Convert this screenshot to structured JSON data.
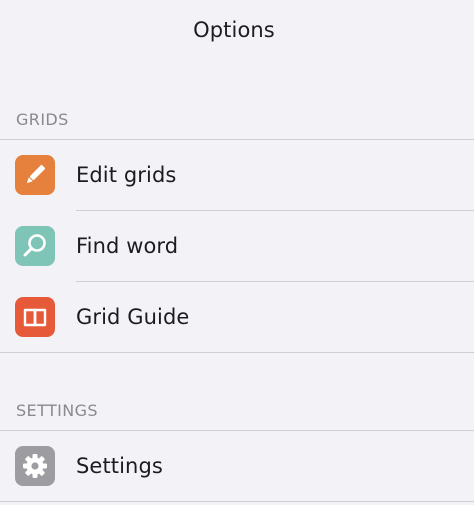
{
  "header": {
    "title": "Options"
  },
  "sections": [
    {
      "title": "GRIDS",
      "items": [
        {
          "label": "Edit grids",
          "icon": "pencil-icon",
          "icon_color": "#e5803d"
        },
        {
          "label": "Find word",
          "icon": "magnifier-icon",
          "icon_color": "#7fc5b7"
        },
        {
          "label": "Grid Guide",
          "icon": "open-book-icon",
          "icon_color": "#e65a3a"
        }
      ]
    },
    {
      "title": "SETTINGS",
      "items": [
        {
          "label": "Settings",
          "icon": "gear-icon",
          "icon_color": "#9d9da1"
        }
      ]
    }
  ],
  "colors": {
    "background": "#f3f2f7",
    "separator": "#cfcfd3",
    "section_header": "#8a8a8e",
    "text": "#1c1c1e"
  }
}
